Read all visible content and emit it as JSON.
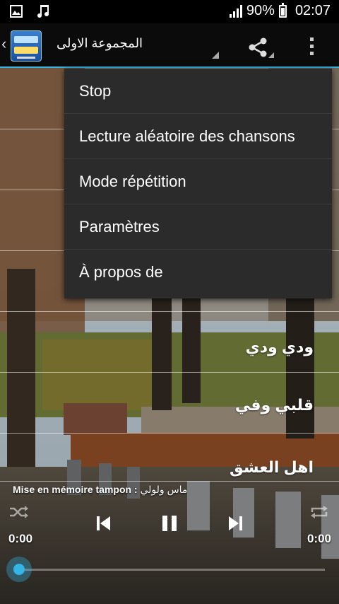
{
  "status_bar": {
    "battery_percent": "90%",
    "time": "02:07"
  },
  "action_bar": {
    "title": "المجموعة الاولى"
  },
  "songs": [
    "ودي ودي",
    "قلبي وفي",
    "اهل العشق"
  ],
  "menu": {
    "items": [
      "Stop",
      "Lecture aléatoire des chansons",
      "Mode répétition",
      "Paramètres",
      "À propos de"
    ]
  },
  "player": {
    "buffer_label": "Mise en mémoire tampon : ",
    "buffer_song": "ماس ولولي",
    "time_elapsed": "0:00",
    "time_total": "0:00",
    "progress_fraction": 0
  },
  "colors": {
    "accent": "#33b5e5",
    "menu_bg": "#2b2b2b"
  }
}
